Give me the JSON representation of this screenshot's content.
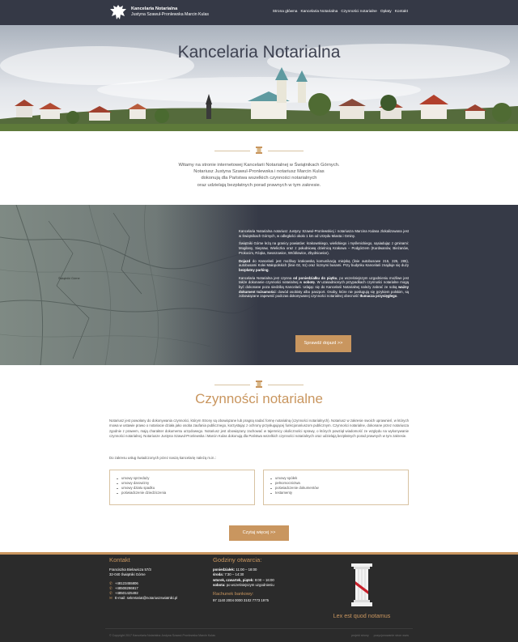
{
  "nav": {
    "brand_title": "Kancelaria Notarialna",
    "brand_subtitle": "Justyna Szawul-Pronlewska Marcin Kulas",
    "menu": [
      "Strona główna",
      "Kancelaria Notarialna",
      "Czynności notarialne",
      "Opłaty",
      "Kontakt"
    ]
  },
  "hero": {
    "title": "Kancelaria Notarialna"
  },
  "welcome": {
    "lines": [
      "Witamy na stronie internetowej Kancelarii Notarialnej w Świątnikach Górnych.",
      "Notariusz Justyna Szawul-Pronlewska i notariusz Marcin Kulas",
      "dokonują dla Państwa wszelkich czynności notarialnych",
      "oraz udzielają bezpłatnych porad prawnych w tym zakresie."
    ]
  },
  "location": {
    "map_label": "Świątniki Górne",
    "p1": "Kancelaria Notarialna notariusz Justyny Szawul-Pronlewskiej i notariusza Marcina Kulasa zlokalizowana jest w Świątnikach Górnych, w odległości około 1 km od Urzędu Miasta i Gminy.",
    "p2": "Świątniki Górne leżą na granicy powiatów: krakowskiego, wielickiego i myślenickiego, sąsiadując z gminami: Mogilany, Siepraw, Wieliczka oraz z południową dzielnicą Krakowa – Podgórzem (Kurdwanów, Bieżanów, Prokocim, Rżąka, Swoszowice, Wróblowice, Zbydniowice).",
    "p3_pre": "Dojazd",
    "p3": " do Kancelarii jest możliwy krakowską komunikacją miejską (linie autobusowe 215, 225, 285), autobusami Kolei Małopolskich (linie 02, 51) oraz licznymi busami. Przy budynku Kancelarii znajduje się duży ",
    "p3_bold": "bezpłatny parking",
    "p3_end": ".",
    "p4_a": "Kancelaria Notarialna jest czynna ",
    "p4_b": "od poniedziałku do piątku",
    "p4_c": ", po wcześniejszym uzgodnieniu możliwe jest także dokonanie czynności notarialnej w ",
    "p4_d": "sobotę",
    "p4_e": ". W uzasadnionych przypadkach czynności notarialne mogą być dokonane poza siedzibą Kancelarii. Udając się do Kancelarii Notarialnej należy zabrać ze sobą ",
    "p4_f": "ważny dokument tożsamości",
    "p4_g": ": dowód osobisty albo paszport. Osoby, które nie posługują się językiem polskim, są zobowiązane zapewnić podczas dokonywanej czynności notarialnej obecność ",
    "p4_h": "tłumacza przysięgłego",
    "p4_i": ".",
    "button": "Sprawdź dojazd >>"
  },
  "services": {
    "title": "Czynności notarialne",
    "intro": "Notariusz jest powołany do dokonywania czynności, którym Strony są obowiązane lub pragną nadać formę notarialną (czynności notarialnych). Notariusz w zakresie swoich uprawnień, w których mowa w ustawie prawo o notariacie działa jako osoba zaufania publicznego, korzystając z ochrony przysługującej funkcjonariuszom publicznym. Czynności notarialne, dokonane przez notariusza zgodnie z prawem, mają charakter dokumentu urzędowego. Notariusz jest obowiązany zachować w tajemnicy okoliczności sprawy, o których powziął wiadomość ze względu na wykonywanie czynności notarialnej. Notariusze Justyna Szawul-Pronlewska i Marcin Kulas dokonują dla Państwa wszelkich czynności notarialnych oraz udzielają bezpłatnych porad prawnych w tym zakresie.",
    "note": "Do zakresu usług świadczonych przez naszą kancelarię należą m.in.:",
    "left_list": [
      "umowy sprzedaży",
      "umowy darowizny",
      "umowy działu spadku",
      "poświadczenie dziedziczenia"
    ],
    "right_list": [
      "umowy spółek",
      "pełnomocnictwa",
      "poświadczenie dokumentów",
      "testamenty"
    ],
    "button": "Czytaj więcej >>"
  },
  "footer": {
    "contact_title": "Kontakt",
    "address1": "Franciszka Bielowicza 57/3",
    "address2": "32-040 Świątniki Górne",
    "phones": [
      "+48123455806",
      "+48508296917",
      "+48501425492"
    ],
    "email": "E-mail: sekretariat@notariuszswiatniki.pl",
    "hours_title": "Godziny otwarcia:",
    "hours": [
      {
        "day": "poniedziałek:",
        "time": " 11:00 – 18:00"
      },
      {
        "day": "środa:",
        "time": " 7:30 – 14:30"
      },
      {
        "day": "wtorek, czwartek, piątek:",
        "time": " 9:00 – 16:00"
      },
      {
        "day": "sobota:",
        "time": " po wcześniejszym uzgodnieniu"
      }
    ],
    "bank_title": "Rachunek bankowy:",
    "bank_number": "97 1140 2004 0000 3102 7773 1975",
    "motto": "Lex est quod notamus",
    "copyright": "© Copyright 2017 Kancelaria Notarialna Justyna Szawul-Pronlewska Marcin Kulas",
    "credits": [
      "projekt strony",
      "pozycjonowanie stron www"
    ]
  },
  "colors": {
    "nav_bg": "#353946",
    "accent": "#c9965f",
    "footer_bg": "#2b2b2b"
  }
}
